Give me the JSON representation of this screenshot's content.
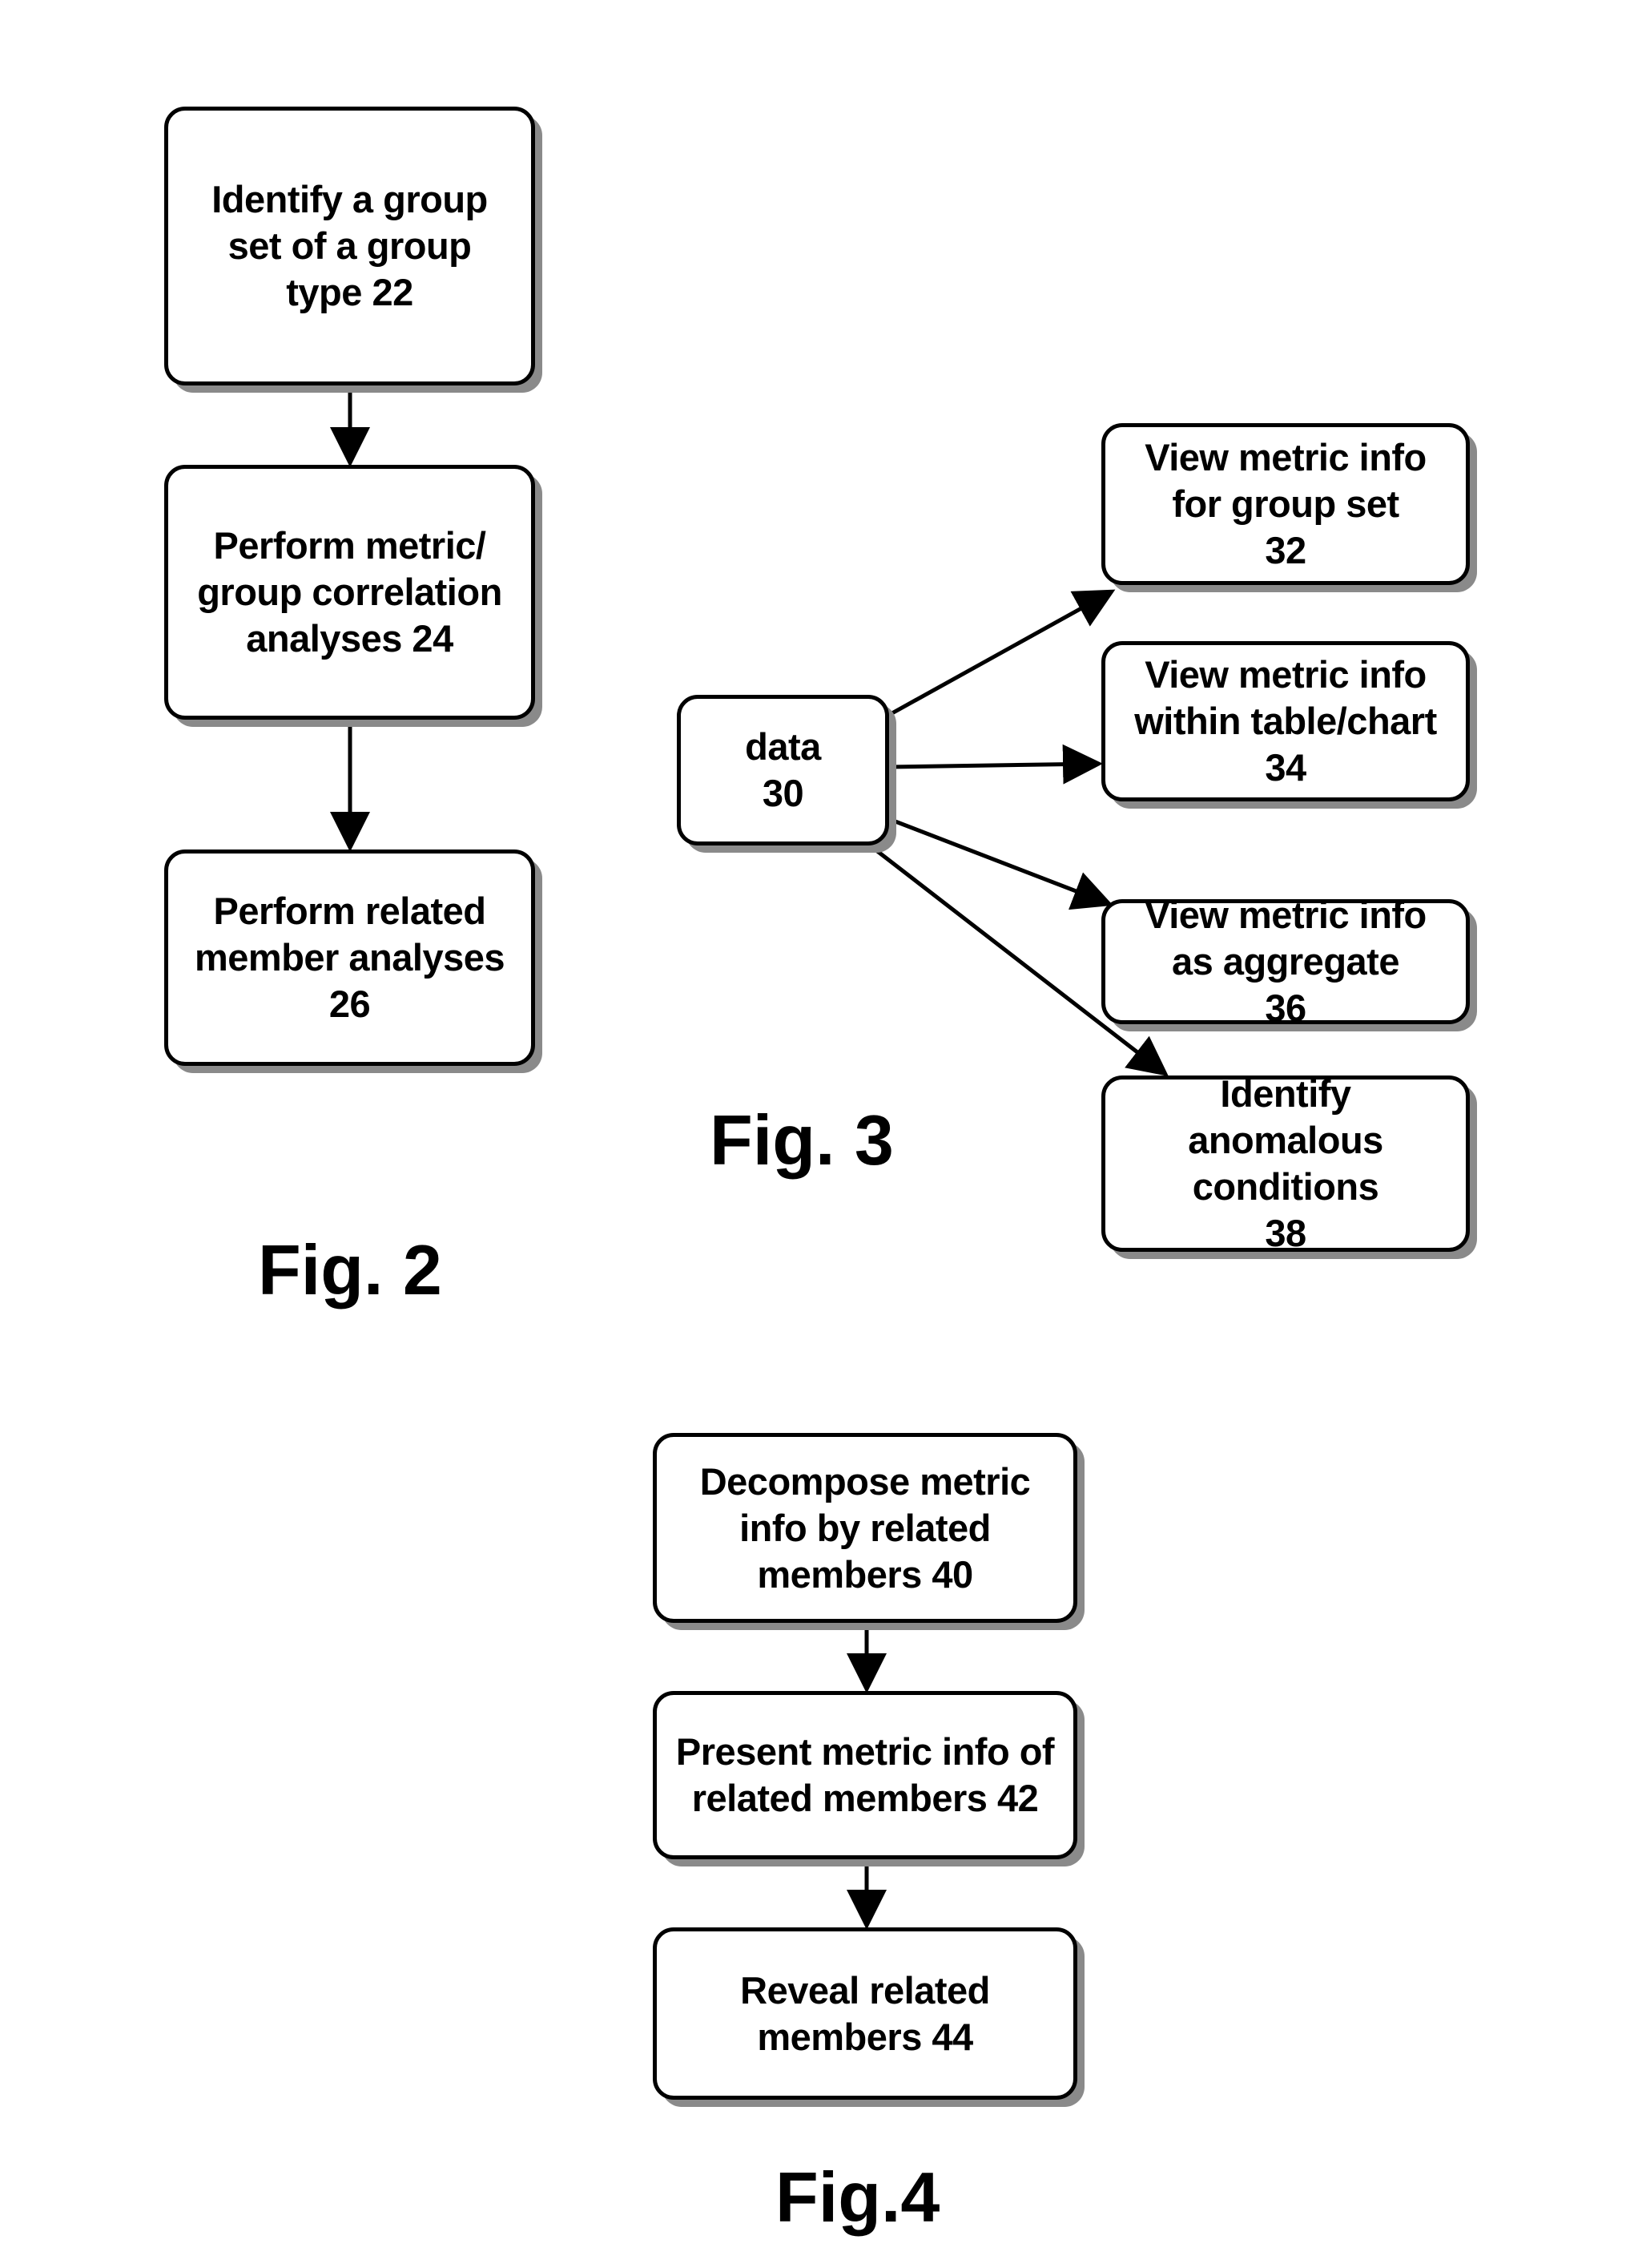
{
  "figures": [
    {
      "caption": "Fig. 2",
      "nodes": [
        {
          "id": "22",
          "text": "Identify a group\nset of a group\ntype    22"
        },
        {
          "id": "24",
          "text": "Perform metric/\ngroup correlation\nanalyses    24"
        },
        {
          "id": "26",
          "text": "Perform related\nmember analyses\n26"
        }
      ],
      "edges": [
        [
          "22",
          "24"
        ],
        [
          "24",
          "26"
        ]
      ]
    },
    {
      "caption": "Fig. 3",
      "nodes": [
        {
          "id": "30",
          "text": "data\n30"
        },
        {
          "id": "32",
          "text": "View metric info\nfor group set\n32"
        },
        {
          "id": "34",
          "text": "View metric info\nwithin table/chart\n34"
        },
        {
          "id": "36",
          "text": "View metric info\nas aggregate\n36"
        },
        {
          "id": "38",
          "text": "Identify\nanomalous\nconditions\n38"
        }
      ],
      "edges": [
        [
          "30",
          "32"
        ],
        [
          "30",
          "34"
        ],
        [
          "30",
          "36"
        ],
        [
          "30",
          "38"
        ]
      ]
    },
    {
      "caption": "Fig.4",
      "nodes": [
        {
          "id": "40",
          "text": "Decompose metric\ninfo by related\nmembers  40"
        },
        {
          "id": "42",
          "text": "Present metric info of\nrelated members 42"
        },
        {
          "id": "44",
          "text": "Reveal related\nmembers  44"
        }
      ],
      "edges": [
        [
          "40",
          "42"
        ],
        [
          "42",
          "44"
        ]
      ]
    }
  ]
}
